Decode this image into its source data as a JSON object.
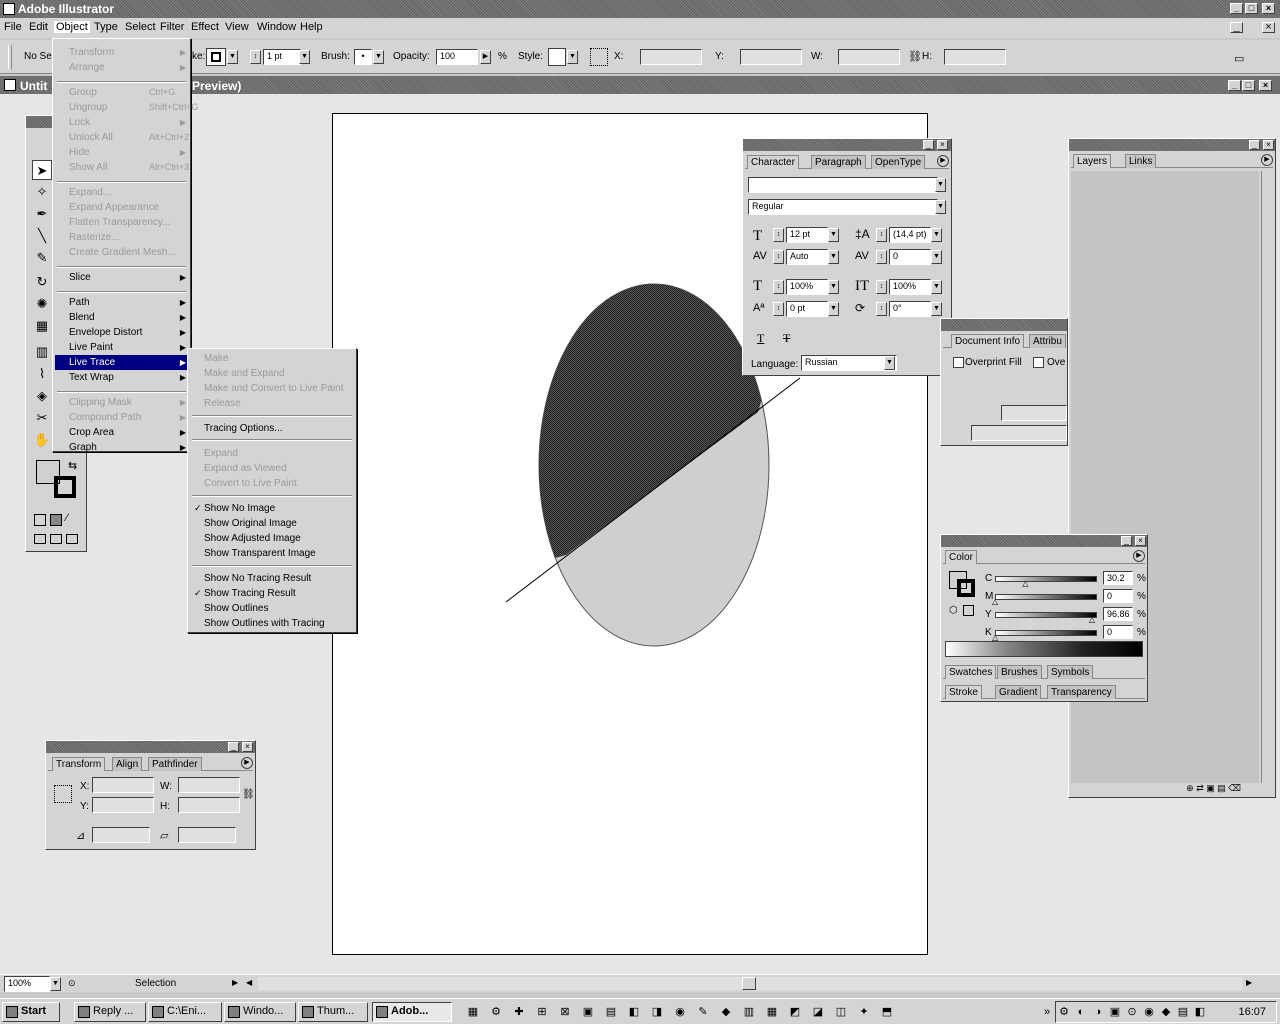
{
  "app": {
    "title": "Adobe Illustrator"
  },
  "menubar": [
    "File",
    "Edit",
    "Object",
    "Type",
    "Select",
    "Filter",
    "Effect",
    "View",
    "Window",
    "Help"
  ],
  "controlbar": {
    "selection_label": "No Se",
    "stroke_label": "ke:",
    "stroke_weight": "1 pt",
    "brush_label": "Brush:",
    "opacity_label": "Opacity:",
    "opacity_value": "100",
    "opacity_unit": "%",
    "style_label": "Style:",
    "x_label": "X:",
    "y_label": "Y:",
    "w_label": "W:",
    "h_label": "H:"
  },
  "document": {
    "title_left": "Untit",
    "title_right": "Preview)"
  },
  "object_menu": {
    "items": [
      {
        "label": "Transform",
        "enabled": false,
        "submenu": true
      },
      {
        "label": "Arrange",
        "enabled": false,
        "submenu": true
      },
      {
        "label": "Group",
        "enabled": false,
        "shortcut": "Ctrl+G"
      },
      {
        "label": "Ungroup",
        "enabled": false,
        "shortcut": "Shift+Ctrl+G"
      },
      {
        "label": "Lock",
        "enabled": false,
        "submenu": true
      },
      {
        "label": "Unlock All",
        "enabled": false,
        "shortcut": "Alt+Ctrl+2"
      },
      {
        "label": "Hide",
        "enabled": false,
        "submenu": true
      },
      {
        "label": "Show All",
        "enabled": false,
        "shortcut": "Alt+Ctrl+3"
      },
      {
        "label": "Expand...",
        "enabled": false
      },
      {
        "label": "Expand Appearance",
        "enabled": false
      },
      {
        "label": "Flatten Transparency...",
        "enabled": false
      },
      {
        "label": "Rasterize...",
        "enabled": false
      },
      {
        "label": "Create Gradient Mesh...",
        "enabled": false
      },
      {
        "label": "Slice",
        "enabled": true,
        "submenu": true
      },
      {
        "label": "Path",
        "enabled": true,
        "submenu": true
      },
      {
        "label": "Blend",
        "enabled": true,
        "submenu": true
      },
      {
        "label": "Envelope Distort",
        "enabled": true,
        "submenu": true
      },
      {
        "label": "Live Paint",
        "enabled": true,
        "submenu": true
      },
      {
        "label": "Live Trace",
        "enabled": true,
        "submenu": true,
        "highlighted": true
      },
      {
        "label": "Text Wrap",
        "enabled": true,
        "submenu": true
      },
      {
        "label": "Clipping Mask",
        "enabled": false,
        "submenu": true
      },
      {
        "label": "Compound Path",
        "enabled": false,
        "submenu": true
      },
      {
        "label": "Crop Area",
        "enabled": true,
        "submenu": true
      },
      {
        "label": "Graph",
        "enabled": true,
        "submenu": true
      }
    ]
  },
  "livetrace_menu": {
    "items": [
      {
        "label": "Make",
        "enabled": false
      },
      {
        "label": "Make and Expand",
        "enabled": false
      },
      {
        "label": "Make and Convert to Live Paint",
        "enabled": false
      },
      {
        "label": "Release",
        "enabled": false
      },
      {
        "label": "Tracing Options...",
        "enabled": true
      },
      {
        "label": "Expand",
        "enabled": false
      },
      {
        "label": "Expand as Viewed",
        "enabled": false
      },
      {
        "label": "Convert to Live Paint",
        "enabled": false
      },
      {
        "label": "Show No Image",
        "enabled": true,
        "checked": true
      },
      {
        "label": "Show Original Image",
        "enabled": true
      },
      {
        "label": "Show Adjusted Image",
        "enabled": true
      },
      {
        "label": "Show Transparent Image",
        "enabled": true
      },
      {
        "label": "Show No Tracing Result",
        "enabled": true
      },
      {
        "label": "Show Tracing Result",
        "enabled": true,
        "checked": true
      },
      {
        "label": "Show Outlines",
        "enabled": true
      },
      {
        "label": "Show Outlines with Tracing",
        "enabled": true
      }
    ]
  },
  "character_panel": {
    "tabs": [
      "Character",
      "Paragraph",
      "OpenType"
    ],
    "font_family": "",
    "font_style": "Regular",
    "font_size": "12 pt",
    "leading": "(14,4 pt)",
    "kerning": "Auto",
    "tracking": "0",
    "vscale": "100%",
    "hscale": "100%",
    "baseline": "0 pt",
    "rotation": "0°",
    "language_label": "Language:",
    "language": "Russian"
  },
  "docinfo_panel": {
    "tabs": [
      "Document Info",
      "Attribu"
    ],
    "overprint_fill": "Overprint Fill",
    "overprint_stroke": "Ove"
  },
  "layers_panel": {
    "tabs": [
      "Layers",
      "Links"
    ]
  },
  "color_panel": {
    "tabs": [
      "Color"
    ],
    "channels": [
      {
        "label": "C",
        "value": "30.2",
        "unit": "%",
        "pos": 0.302
      },
      {
        "label": "M",
        "value": "0",
        "unit": "%",
        "pos": 0
      },
      {
        "label": "Y",
        "value": "96.86",
        "unit": "%",
        "pos": 0.9686
      },
      {
        "label": "K",
        "value": "0",
        "unit": "%",
        "pos": 0
      }
    ],
    "sub_tabs": [
      "Swatches",
      "Brushes",
      "Symbols"
    ],
    "sub_tabs2": [
      "Stroke",
      "Gradient",
      "Transparency"
    ]
  },
  "transform_panel": {
    "tabs": [
      "Transform",
      "Align",
      "Pathfinder"
    ],
    "x_label": "X:",
    "y_label": "Y:",
    "w_label": "W:",
    "h_label": "H:"
  },
  "statusbar": {
    "zoom": "100%",
    "tool": "Selection"
  },
  "taskbar": {
    "start": "Start",
    "buttons": [
      "Reply ...",
      "C:\\Eni...",
      "Windo...",
      "Thum...",
      "Adob..."
    ],
    "active_index": 4,
    "clock": "16:07"
  }
}
